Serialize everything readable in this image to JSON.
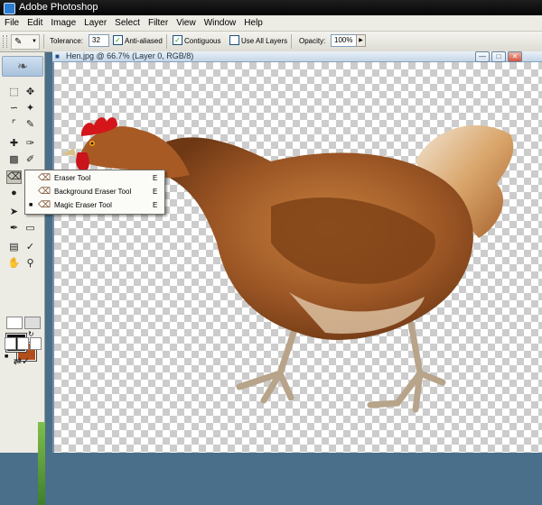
{
  "app": {
    "title": "Adobe Photoshop"
  },
  "menu": [
    "File",
    "Edit",
    "Image",
    "Layer",
    "Select",
    "Filter",
    "View",
    "Window",
    "Help"
  ],
  "options": {
    "tolerance_label": "Tolerance:",
    "tolerance_value": "32",
    "anti_aliased_label": "Anti-aliased",
    "contiguous_label": "Contiguous",
    "use_all_layers_label": "Use All Layers",
    "opacity_label": "Opacity:",
    "opacity_value": "100%",
    "anti_aliased_checked": true,
    "contiguous_checked": true,
    "use_all_layers_checked": false
  },
  "document": {
    "title": "Hen.jpg @ 66.7% (Layer 0, RGB/8)"
  },
  "flyout": {
    "items": [
      {
        "label": "Eraser Tool",
        "shortcut": "E",
        "selected": false
      },
      {
        "label": "Background Eraser Tool",
        "shortcut": "E",
        "selected": false
      },
      {
        "label": "Magic Eraser Tool",
        "shortcut": "E",
        "selected": true
      }
    ]
  },
  "colors": {
    "foreground": "#111111",
    "background": "#b24e1a"
  },
  "icons": [
    "marquee-icon",
    "move-icon",
    "lasso-icon",
    "magic-wand-icon",
    "crop-icon",
    "slice-icon",
    "healing-icon",
    "brush-icon",
    "stamp-icon",
    "history-brush-icon",
    "eraser-icon",
    "gradient-icon",
    "blur-icon",
    "dodge-icon",
    "path-select-icon",
    "type-icon",
    "pen-icon",
    "shape-icon",
    "notes-icon",
    "eyedropper-icon",
    "hand-icon",
    "zoom-icon"
  ]
}
